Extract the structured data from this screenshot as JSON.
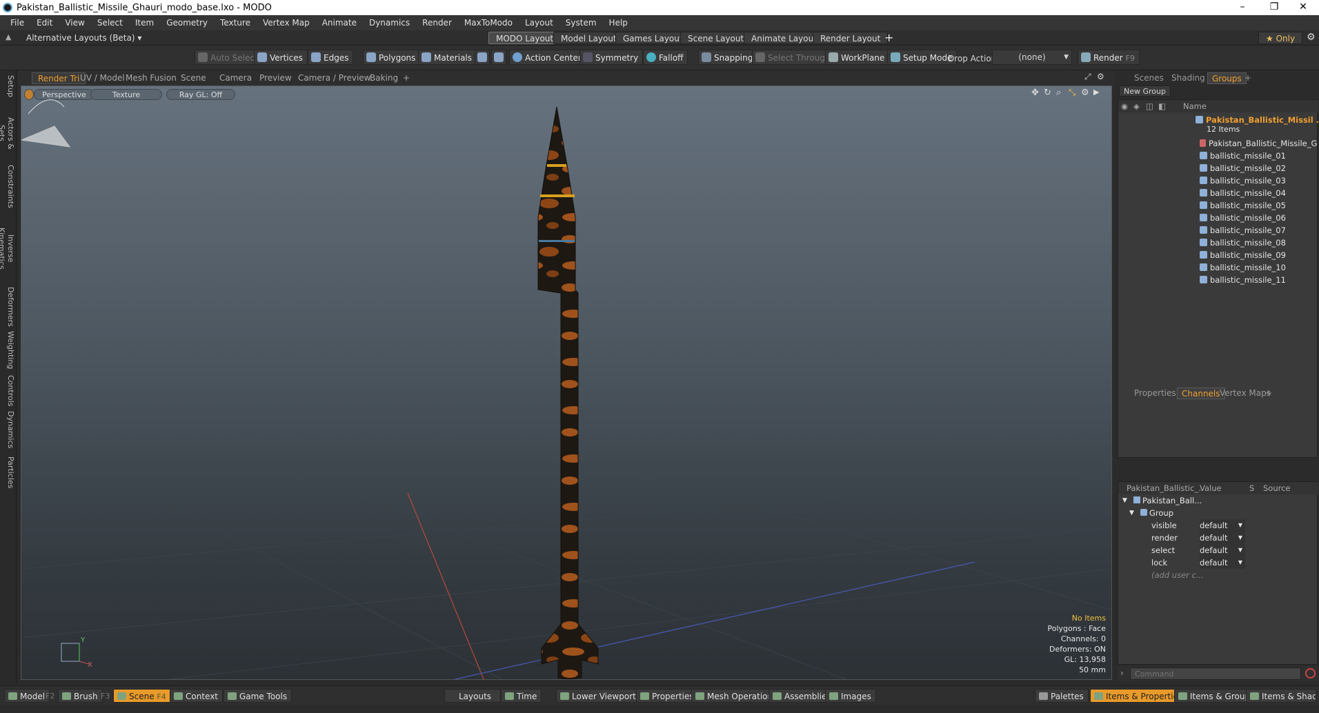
{
  "window": {
    "title": "Pakistan_Ballistic_Missile_Ghauri_modo_base.lxo - MODO",
    "minimize": "–",
    "maximize": "❐",
    "close": "✕"
  },
  "menu": [
    "File",
    "Edit",
    "View",
    "Select",
    "Item",
    "Geometry",
    "Texture",
    "Vertex Map",
    "Animate",
    "Dynamics",
    "Render",
    "MaxToModo",
    "Layout",
    "System",
    "Help"
  ],
  "layouts": {
    "selector": "Alternative Layouts (Beta)",
    "tabs": [
      "MODO Layout",
      "Model Layout",
      "Games Layout",
      "Scene Layout",
      "Animate Layout",
      "Render Layout"
    ],
    "add": "+",
    "only_label": "★ Only"
  },
  "toolbar": {
    "auto_select": "Auto Select",
    "vertices": "Vertices",
    "edges": "Edges",
    "polygons": "Polygons",
    "materials": "Materials",
    "action_center": "Action Center",
    "symmetry": "Symmetry",
    "falloff": "Falloff",
    "snapping": "Snapping",
    "select_through": "Select Through",
    "workplane": "WorkPlane",
    "setup_mode": "Setup Mode",
    "drop_action_label": "Drop Action",
    "drop_action_value": "(none)",
    "render": "Render",
    "render_key": "F9"
  },
  "left_tabs": [
    "Setup",
    "Actors & Sets",
    "Constraints",
    "Inverse Kinematics",
    "Deformers",
    "Weighting",
    "Controls",
    "Dynamics",
    "Particles"
  ],
  "viewport_tabs": [
    "Render Tri",
    "UV / Model",
    "Mesh Fusion",
    "Scene",
    "Camera",
    "Preview",
    "Camera / Preview",
    "Baking",
    "+"
  ],
  "viewport": {
    "view": "Perspective",
    "shading": "Texture",
    "raygl": "Ray GL: Off",
    "info": [
      "No Items",
      "Polygons : Face",
      "Channels: 0",
      "Deformers: ON",
      "GL: 13,958",
      "50 mm"
    ]
  },
  "right_tabs": [
    "Scenes",
    "Shading",
    "Groups",
    "+"
  ],
  "groups": {
    "new_group": "New Group",
    "col_name": "Name",
    "root": "Pakistan_Ballistic_Missil ...",
    "count": "12 Items",
    "items": [
      "Pakistan_Ballistic_Missile_G ...",
      "ballistic_missile_01",
      "ballistic_missile_02",
      "ballistic_missile_03",
      "ballistic_missile_04",
      "ballistic_missile_05",
      "ballistic_missile_06",
      "ballistic_missile_07",
      "ballistic_missile_08",
      "ballistic_missile_09",
      "ballistic_missile_10",
      "ballistic_missile_11"
    ]
  },
  "props_tabs": [
    "Properties",
    "Channels",
    "Vertex Maps",
    "+"
  ],
  "channels": {
    "col_item": "Pakistan_Ballistic_...",
    "col_value": "Value",
    "col_s": "S",
    "col_source": "Source",
    "root": "Pakistan_Ball...",
    "group": "Group",
    "rows": [
      {
        "name": "visible",
        "value": "default"
      },
      {
        "name": "render",
        "value": "default"
      },
      {
        "name": "select",
        "value": "default"
      },
      {
        "name": "lock",
        "value": "default"
      }
    ],
    "add_user": "(add user c..."
  },
  "command_placeholder": "Command",
  "statusbar": {
    "model": "Model",
    "model_key": "F2",
    "brush": "Brush",
    "brush_key": "F3",
    "scene": "Scene",
    "scene_key": "F4",
    "context": "Context",
    "game_tools": "Game Tools",
    "layouts": "Layouts",
    "time": "Time",
    "lower_viewports": "Lower Viewports",
    "properties": "Properties",
    "mesh_operations": "Mesh Operations",
    "assemblies": "Assemblies",
    "images": "Images",
    "palettes": "Palettes",
    "items_properties": "Items & Properties",
    "items_groups": "Items & Groups",
    "items_shading": "Items & Shading"
  },
  "colors": {
    "accent": "#f0a030",
    "missile_body": "#1e1812",
    "missile_camo": "#a0521c"
  }
}
